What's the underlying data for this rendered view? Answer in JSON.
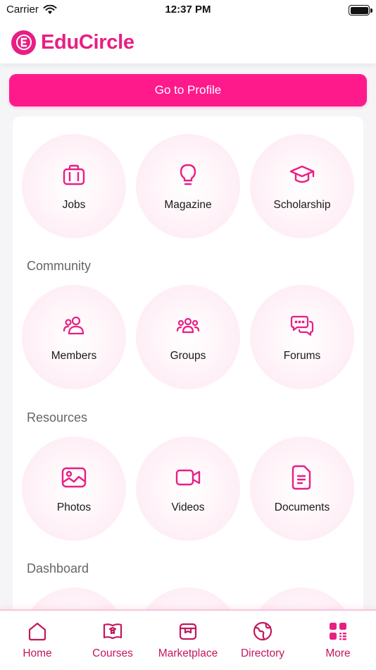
{
  "status_bar": {
    "carrier": "Carrier",
    "time": "12:37 PM"
  },
  "header": {
    "app_name": "EduCircle"
  },
  "profile_button": {
    "label": "Go to Profile"
  },
  "top_tiles": [
    {
      "label": "Jobs",
      "icon": "briefcase-icon"
    },
    {
      "label": "Magazine",
      "icon": "lightbulb-icon"
    },
    {
      "label": "Scholarship",
      "icon": "graduation-cap-icon"
    }
  ],
  "sections": [
    {
      "title": "Community",
      "tiles": [
        {
          "label": "Members",
          "icon": "members-icon"
        },
        {
          "label": "Groups",
          "icon": "groups-icon"
        },
        {
          "label": "Forums",
          "icon": "chat-bubbles-icon"
        }
      ]
    },
    {
      "title": "Resources",
      "tiles": [
        {
          "label": "Photos",
          "icon": "image-icon"
        },
        {
          "label": "Videos",
          "icon": "video-camera-icon"
        },
        {
          "label": "Documents",
          "icon": "document-icon"
        }
      ]
    },
    {
      "title": "Dashboard"
    }
  ],
  "tab_bar": [
    {
      "label": "Home",
      "icon": "home-icon"
    },
    {
      "label": "Courses",
      "icon": "courses-icon"
    },
    {
      "label": "Marketplace",
      "icon": "marketplace-icon"
    },
    {
      "label": "Directory",
      "icon": "globe-icon"
    },
    {
      "label": "More",
      "icon": "grid-icon"
    }
  ],
  "colors": {
    "accent": "#e91e84",
    "button": "#ff1a8c",
    "tab_text": "#c2185b"
  }
}
